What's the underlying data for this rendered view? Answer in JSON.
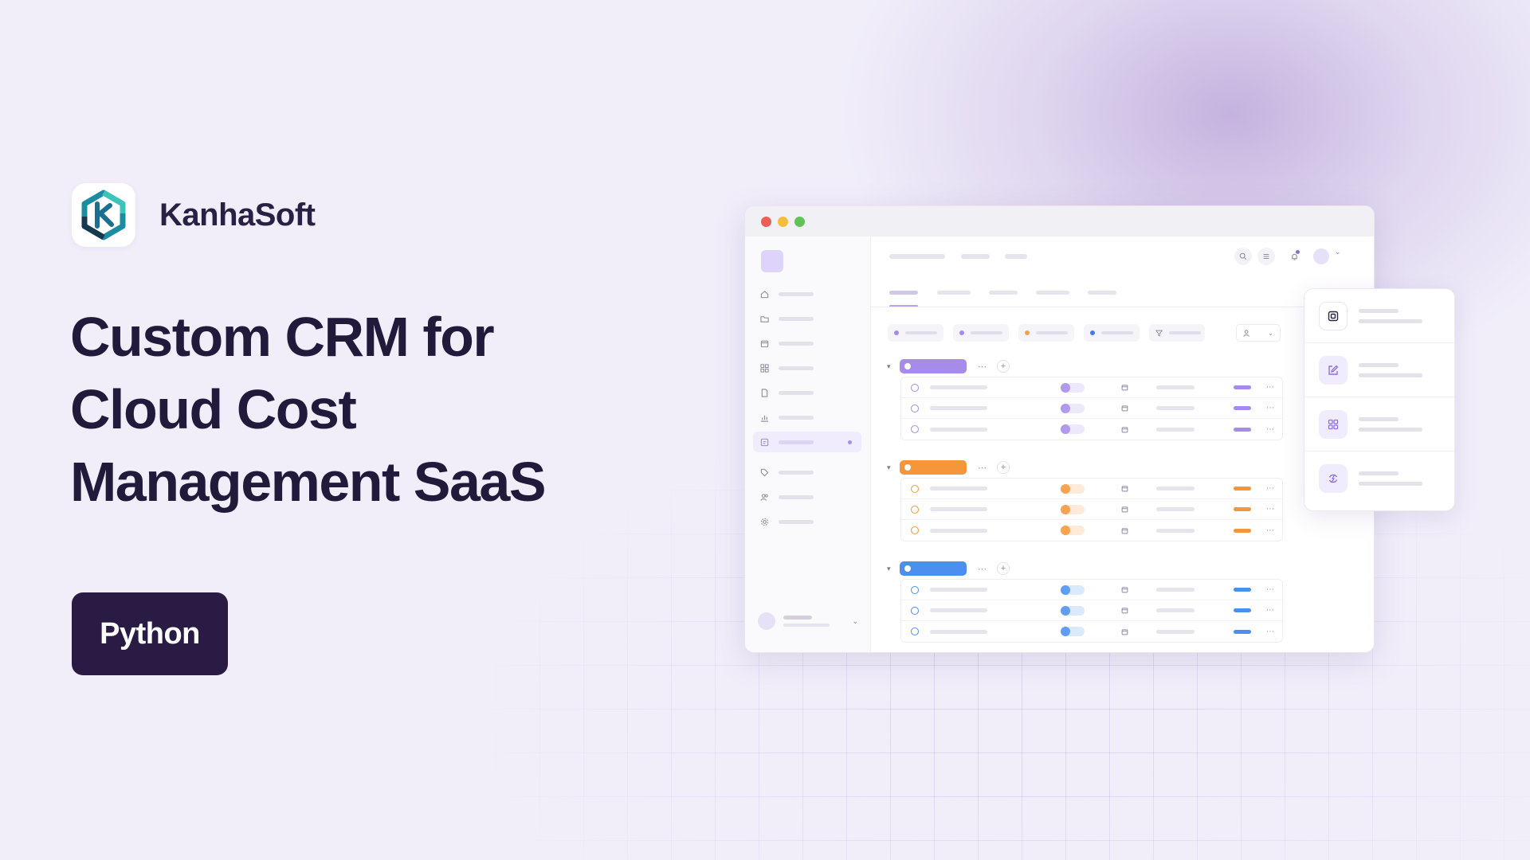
{
  "brand": {
    "name": "KanhaSoft",
    "logo_icon": "hexagon-k-logo"
  },
  "headline": {
    "lines": [
      "Custom CRM for",
      "Cloud Cost",
      "Management SaaS"
    ]
  },
  "badge": {
    "label": "Python",
    "color": "#2a1b45"
  },
  "mockup": {
    "window_controls": [
      "#ec5f57",
      "#f4bd3d",
      "#5fc455"
    ],
    "sidebar_icons": [
      "home-icon",
      "folder-icon",
      "calendar-icon",
      "grid-icon",
      "document-icon",
      "chart-icon",
      "task-list-icon",
      "tag-icon",
      "users-icon",
      "settings-icon"
    ],
    "header_icons": [
      "search-icon",
      "menu-icon",
      "bell-icon",
      "avatar",
      "chevron-down-icon"
    ],
    "filter_chip_colors": [
      "#a68bea",
      "#a68bea",
      "#f6a04b",
      "#3f7fe0"
    ],
    "groups": [
      {
        "color": "#a68bea",
        "rows": 3
      },
      {
        "color": "#f6963b",
        "rows": 3
      },
      {
        "color": "#4b8ff0",
        "rows": 3
      }
    ],
    "floating_panel_icons": [
      "box-icon",
      "edit-icon",
      "grid-icon",
      "refresh-icon"
    ]
  }
}
